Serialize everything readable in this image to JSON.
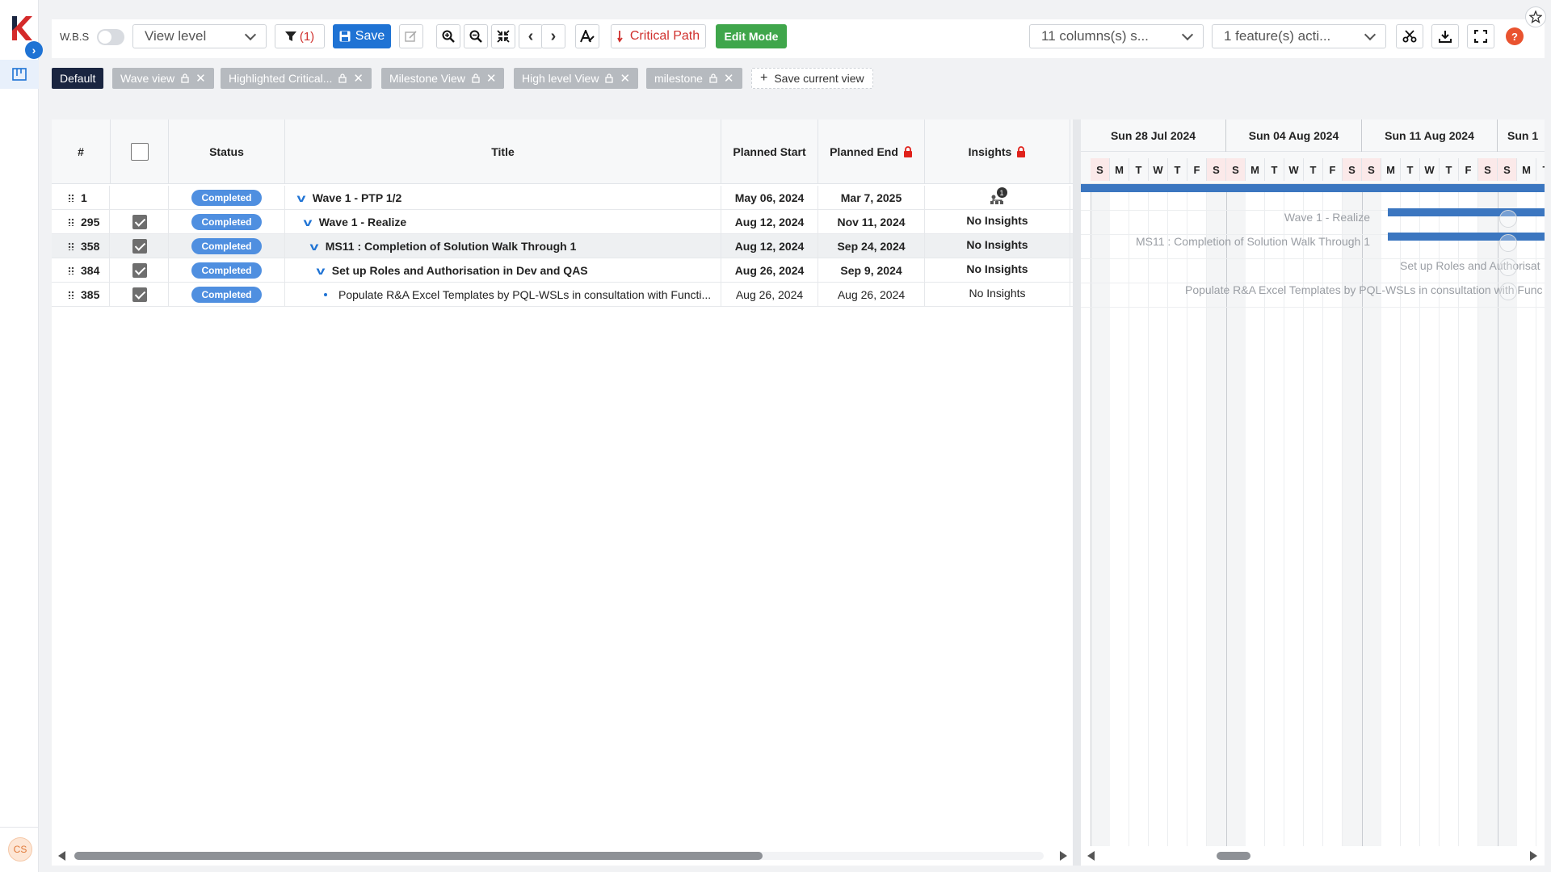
{
  "rail": {
    "avatar_initials": "CS"
  },
  "toolbar": {
    "wbs_label": "W.B.S",
    "view_level": "View level",
    "filter_count": "(1)",
    "save_label": "Save",
    "critical_path_label": "Critical Path",
    "edit_mode_label": "Edit Mode",
    "columns_select": "11 columns(s) s...",
    "features_select": "1 feature(s) acti...",
    "help_label": "?"
  },
  "views": [
    {
      "label": "Default"
    },
    {
      "label": "Wave view"
    },
    {
      "label": "Highlighted Critical..."
    },
    {
      "label": "Milestone View"
    },
    {
      "label": "High level View"
    },
    {
      "label": "milestone"
    }
  ],
  "save_view_label": "Save current view",
  "grid": {
    "columns": {
      "num": "#",
      "status": "Status",
      "title": "Title",
      "planned_start": "Planned Start",
      "planned_end": "Planned End",
      "insights": "Insights"
    },
    "rows": [
      {
        "id": "1",
        "checked": false,
        "status": "Completed",
        "title": "Wave 1 - PTP 1/2",
        "start": "May 06, 2024",
        "end": "Mar 7, 2025",
        "insights": "1",
        "bold": true
      },
      {
        "id": "295",
        "checked": true,
        "status": "Completed",
        "title": "Wave 1 - Realize",
        "start": "Aug 12, 2024",
        "end": "Nov 11, 2024",
        "insights": "No Insights",
        "bold": true
      },
      {
        "id": "358",
        "checked": true,
        "status": "Completed",
        "title": "MS11 : Completion of Solution Walk Through 1",
        "start": "Aug 12, 2024",
        "end": "Sep 24, 2024",
        "insights": "No Insights",
        "bold": true
      },
      {
        "id": "384",
        "checked": true,
        "status": "Completed",
        "title": "Set up Roles and Authorisation in Dev and QAS",
        "start": "Aug 26, 2024",
        "end": "Sep 9, 2024",
        "insights": "No Insights",
        "bold": true
      },
      {
        "id": "385",
        "checked": true,
        "status": "Completed",
        "title": "Populate R&A Excel Templates by PQL-WSLs in consultation with Functi...",
        "start": "Aug 26, 2024",
        "end": "Aug 26, 2024",
        "insights": "No Insights",
        "bold": false
      }
    ]
  },
  "gantt": {
    "weeks": [
      "Sun 28 Jul 2024",
      "Sun 04 Aug 2024",
      "Sun 11 Aug 2024",
      "Sun 1"
    ],
    "days": [
      "S",
      "M",
      "T",
      "W",
      "T",
      "F",
      "S",
      "S",
      "M",
      "T",
      "W",
      "T",
      "F",
      "S",
      "S",
      "M",
      "T",
      "W",
      "T",
      "F",
      "S",
      "S",
      "M",
      "T"
    ],
    "labels": [
      "Wave 1 - Realize",
      "MS11 : Completion of Solution Walk Through 1",
      "Set up Roles and Authorisat",
      "Populate R&A Excel Templates by PQL-WSLs in consultation with Func"
    ]
  },
  "colors": {
    "accent": "#1f73d4",
    "badge": "#4f8fe0",
    "edit_mode": "#3fa64b",
    "critical": "#d0302d",
    "bar": "#3b76c0"
  }
}
